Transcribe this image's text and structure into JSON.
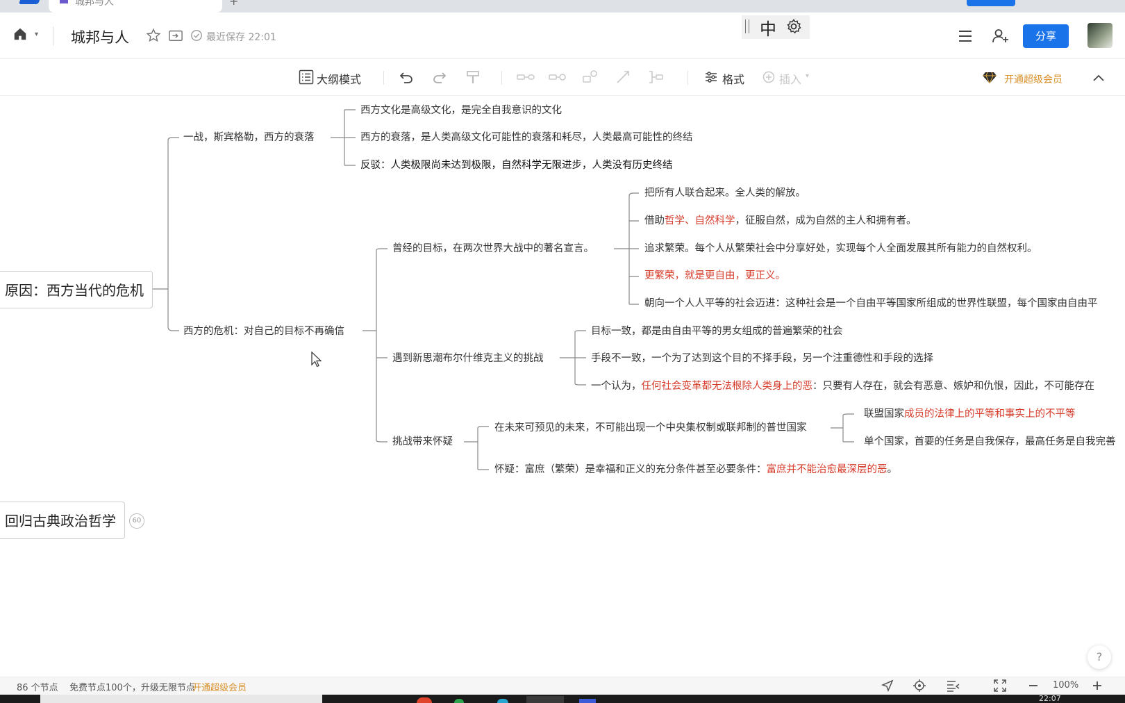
{
  "browser": {
    "tab_title": "城邦与人",
    "new_tab": "+"
  },
  "header": {
    "doc_title": "城邦与人",
    "save_status": "最近保存 22:01",
    "share_label": "分享",
    "ime_label": "中"
  },
  "toolbar": {
    "outline_label": "大纲模式",
    "format_label": "格式",
    "insert_label": "插入",
    "vip_label": "开通超级会员"
  },
  "mindmap": {
    "root1": "原因：西方当代的危机",
    "root2": "回归古典政治哲学",
    "root2_badge": "60",
    "b1": "一战，斯宾格勒，西方的衰落",
    "b1_c1": "西方文化是高级文化，是完全自我意识的文化",
    "b1_c2": "西方的衰落，是人类高级文化可能性的衰落和耗尽，人类最高可能性的终结",
    "b1_c3": "反驳：人类极限尚未达到极限，自然科学无限进步，人类没有历史终结",
    "b2": "西方的危机：对自己的目标不再确信",
    "g1": "曾经的目标，在两次世界大战中的著名宣言。",
    "g1_c1": "把所有人联合起来。全人类的解放。",
    "g1_c2_a": "借助",
    "g1_c2_b": "哲学、自然科学",
    "g1_c2_c": "，征服自然，成为自然的主人和拥有者。",
    "g1_c3": "追求繁荣。每个人从繁荣社会中分享好处，实现每个人全面发展其所有能力的自然权利。",
    "g1_c4": "更繁荣，就是更自由，更正义。",
    "g1_c5": "朝向一个人人平等的社会迈进：这种社会是一个自由平等国家所组成的世界性联盟，每个国家由自由平",
    "g2": "遇到新思潮布尔什维克主义的挑战",
    "g2_c1": "目标一致，都是由自由平等的男女组成的普遍繁荣的社会",
    "g2_c2": "手段不一致，一个为了达到这个目的不择手段，另一个注重德性和手段的选择",
    "g2_c3_a": "一个认为，",
    "g2_c3_b": "任何社会变革都无法根除人类身上的恶",
    "g2_c3_c": "：只要有人存在，就会有恶意、嫉妒和仇恨，因此，不可能存在",
    "g3": "挑战带来怀疑",
    "g3_c1": "在未来可预见的未来，不可能出现一个中央集权制或联邦制的普世国家",
    "g3_c1_c1_a": "联盟国家",
    "g3_c1_c1_b": "成员的法律上的平等和事实上的不平等",
    "g3_c1_c2": "单个国家，首要的任务是自我保存，最高任务是自我完善",
    "g3_c2_a": "怀疑：富庶（繁荣）是幸福和正义的充分条件甚至必要条件：",
    "g3_c2_b": "富庶并不能治愈最深层的恶",
    "g3_c2_c": "。"
  },
  "help": "?",
  "statusbar": {
    "node_count": "86 个节点",
    "free_nodes": "免费节点100个，升级无限节点",
    "upgrade_link": "开通超级会员",
    "zoom": "100%",
    "clock": "22:07"
  },
  "colors": {
    "accent": "#1a73e8",
    "vip": "#d9912a",
    "highlight_red": "#d63b2a"
  }
}
